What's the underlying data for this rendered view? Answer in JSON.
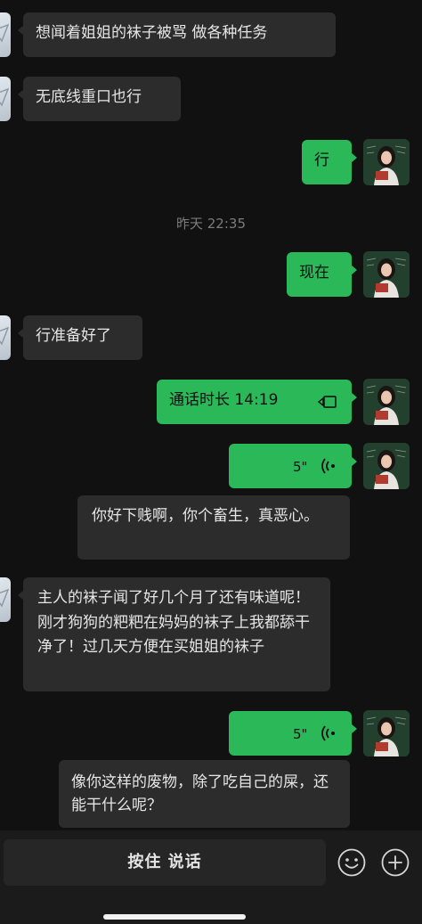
{
  "chat": {
    "messages": [
      {
        "side": "in",
        "text": "想闻着姐姐的袜子被骂 做各种任务"
      },
      {
        "side": "in",
        "text": "无底线重口也行"
      },
      {
        "side": "out",
        "text": "行"
      },
      {
        "side": "out",
        "text": "现在"
      },
      {
        "side": "in",
        "text": "行准备好了"
      },
      {
        "side": "out",
        "text": "通话时长 14:19"
      },
      {
        "side": "out",
        "type": "voice",
        "duration": "5\""
      },
      {
        "side": "in",
        "text": "你好下贱啊，你个畜生，真恶心。"
      },
      {
        "side": "in",
        "text": "主人的袜子闻了好几个月了还有味道呢！刚才狗狗的粑粑在妈妈的袜子上我都舔干净了！过几天方便在买姐姐的袜子"
      },
      {
        "side": "out",
        "type": "voice",
        "duration": "5\""
      },
      {
        "side": "in",
        "text": "像你这样的废物，除了吃自己的屎，还能干什么呢？"
      }
    ],
    "timestamp": "昨天 22:35"
  },
  "input_bar": {
    "hold_to_talk_label": "按住 说话",
    "icons": [
      "emoji-icon",
      "plus-icon"
    ]
  },
  "colors": {
    "background": "#111111",
    "outgoing_bubble": "#2bb859",
    "incoming_bubble": "#2c2c2c"
  }
}
